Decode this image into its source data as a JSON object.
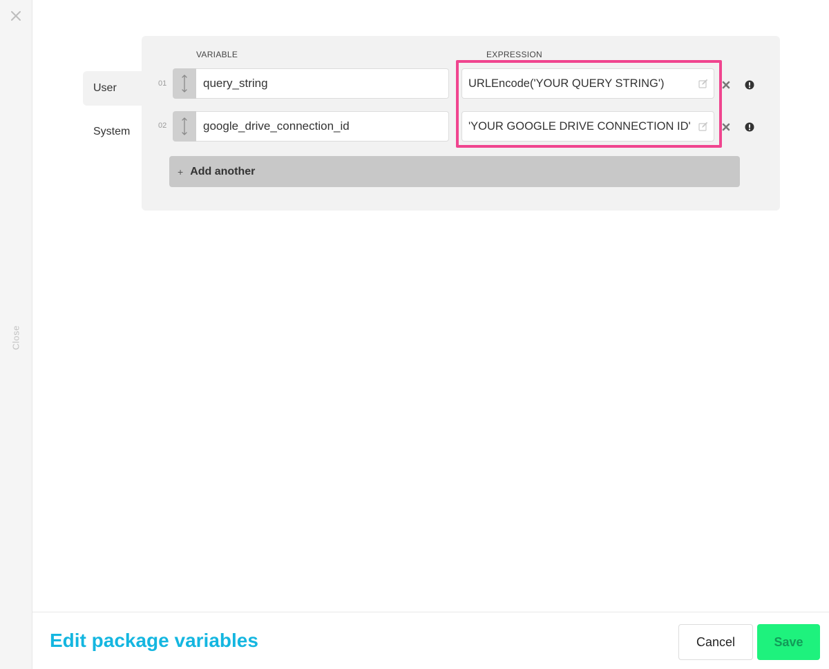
{
  "rail": {
    "close_label": "Close",
    "close_icon": "close-x-icon"
  },
  "tabs": {
    "user": "User",
    "system": "System"
  },
  "columns": {
    "variable": "VARIABLE",
    "expression": "EXPRESSION"
  },
  "rows": [
    {
      "num": "01",
      "variable": "query_string",
      "expression": "URLEncode('YOUR QUERY STRING')"
    },
    {
      "num": "02",
      "variable": "google_drive_connection_id",
      "expression": "'YOUR GOOGLE DRIVE CONNECTION ID'"
    }
  ],
  "add": {
    "plus": "+",
    "label": "Add another"
  },
  "footer": {
    "title": "Edit package variables",
    "cancel": "Cancel",
    "save": "Save"
  },
  "colors": {
    "accent": "#14b6e0",
    "save": "#1ef27d",
    "highlight": "#f0458f"
  }
}
